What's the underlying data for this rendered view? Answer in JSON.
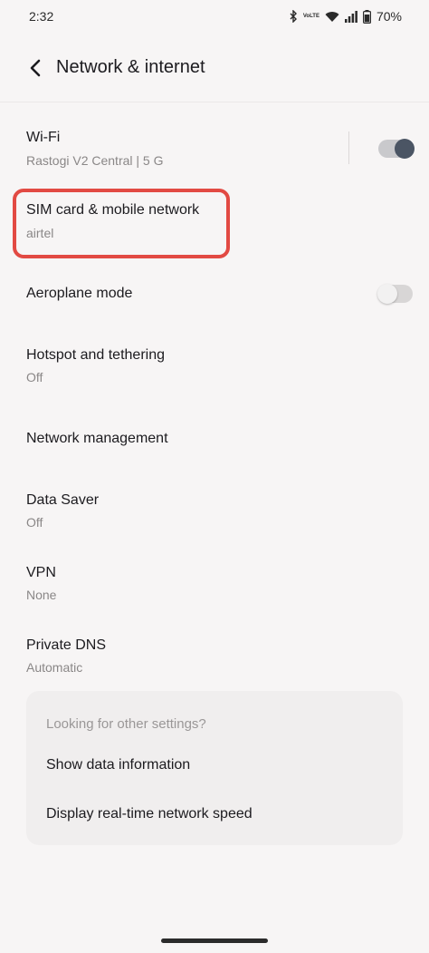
{
  "status": {
    "time": "2:32",
    "battery": "70%",
    "icons": [
      "bluetooth-icon",
      "volte-icon",
      "wifi-icon",
      "signal-icon",
      "battery-icon"
    ],
    "volte_text": "VoLTE"
  },
  "header": {
    "title": "Network & internet",
    "back_icon": "back-arrow-icon"
  },
  "items": [
    {
      "title": "Wi-Fi",
      "subtitle": "Rastogi V2 Central |  5 G",
      "toggle": true
    },
    {
      "title": "SIM card & mobile network",
      "subtitle": "airtel"
    },
    {
      "title": "Aeroplane mode",
      "toggle": false
    },
    {
      "title": "Hotspot and tethering",
      "subtitle": "Off"
    },
    {
      "title": "Network management"
    },
    {
      "title": "Data Saver",
      "subtitle": "Off"
    },
    {
      "title": "VPN",
      "subtitle": "None"
    },
    {
      "title": "Private DNS",
      "subtitle": "Automatic"
    }
  ],
  "card": {
    "hint": "Looking for other settings?",
    "links": [
      "Show data information",
      "Display real-time network speed"
    ]
  },
  "colors": {
    "highlight": "#e24a43",
    "toggle_on_knob": "#4b5564",
    "background": "#f7f5f5"
  }
}
